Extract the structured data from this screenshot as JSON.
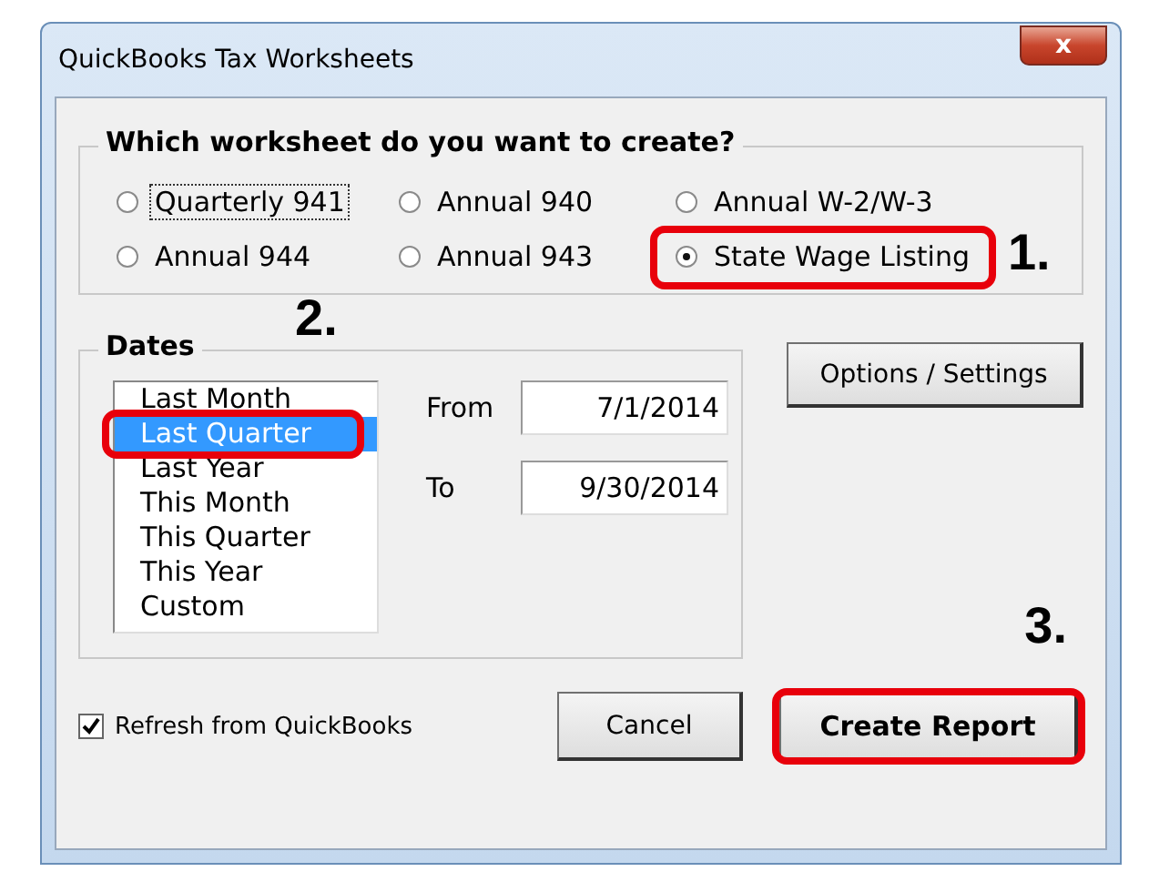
{
  "window": {
    "title": "QuickBooks Tax Worksheets",
    "close": "x"
  },
  "worksheet_group": {
    "legend": "Which worksheet do you want to create?",
    "options": [
      {
        "label": "Quarterly 941",
        "selected": false,
        "focused": true
      },
      {
        "label": "Annual 940",
        "selected": false,
        "focused": false
      },
      {
        "label": "Annual W-2/W-3",
        "selected": false,
        "focused": false
      },
      {
        "label": "Annual 944",
        "selected": false,
        "focused": false
      },
      {
        "label": "Annual 943",
        "selected": false,
        "focused": false
      },
      {
        "label": "State Wage Listing",
        "selected": true,
        "focused": false,
        "callout": "1."
      }
    ]
  },
  "dates_group": {
    "legend": "Dates",
    "callout": "2.",
    "items": [
      {
        "label": "Last Month",
        "selected": false
      },
      {
        "label": "Last Quarter",
        "selected": true
      },
      {
        "label": "Last Year",
        "selected": false
      },
      {
        "label": "This Month",
        "selected": false
      },
      {
        "label": "This Quarter",
        "selected": false
      },
      {
        "label": "This Year",
        "selected": false
      },
      {
        "label": "Custom",
        "selected": false
      }
    ],
    "from": {
      "label": "From",
      "value": "7/1/2014"
    },
    "to": {
      "label": "To",
      "value": "9/30/2014"
    }
  },
  "options_button": "Options / Settings",
  "refresh": {
    "label": "Refresh from QuickBooks",
    "checked": true
  },
  "buttons": [
    {
      "label": "Cancel",
      "kind": "normal"
    },
    {
      "label": "Create Report",
      "kind": "primary",
      "callout": "3."
    }
  ]
}
